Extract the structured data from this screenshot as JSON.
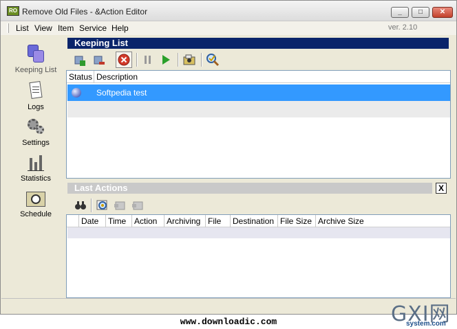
{
  "window": {
    "title": "Remove Old Files - &Action Editor",
    "app_icon_text": "RO",
    "controls": {
      "minimize": "_",
      "maximize": "□",
      "close": "✕"
    }
  },
  "menu": {
    "items": [
      "List",
      "View",
      "Item",
      "Service",
      "Help"
    ],
    "version": "ver. 2.10"
  },
  "sidebar": {
    "items": [
      {
        "label": "Keeping List",
        "icon": "keeping-list-icon",
        "active": true
      },
      {
        "label": "Logs",
        "icon": "logs-icon"
      },
      {
        "label": "Settings",
        "icon": "settings-icon"
      },
      {
        "label": "Statistics",
        "icon": "statistics-icon"
      },
      {
        "label": "Schedule",
        "icon": "schedule-icon"
      }
    ]
  },
  "keeping_list": {
    "header": "Keeping List",
    "toolbar": [
      "add-icon",
      "remove-icon",
      "stop-icon",
      "pause-icon",
      "play-icon",
      "preview-icon",
      "search-icon"
    ],
    "columns": [
      "Status",
      "Description"
    ],
    "rows": [
      {
        "description": "Softpedia test",
        "selected": true
      }
    ]
  },
  "last_actions": {
    "header": "Last Actions",
    "close": "X",
    "toolbar": [
      "find-icon",
      "refresh-icon",
      "export-icon",
      "clear-icon"
    ],
    "columns": [
      "Date",
      "Time",
      "Action",
      "Archiving",
      "File",
      "Destination",
      "File Size",
      "Archive Size"
    ]
  },
  "footer": {
    "text": "www.downloadic.com"
  },
  "watermark": {
    "big": "GXI网",
    "small": "system.com"
  },
  "colors": {
    "header_active": "#0a246a",
    "selection": "#3399ff",
    "window_bg": "#ece9d8"
  }
}
